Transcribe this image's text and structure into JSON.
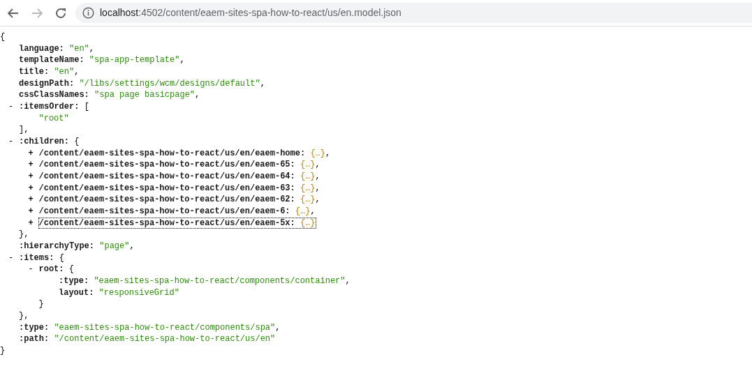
{
  "browser": {
    "back": {
      "disabled": false
    },
    "forward": {
      "disabled": true
    },
    "address": {
      "host": "localhost",
      "path": ":4502/content/eaem-sites-spa-how-to-react/us/en.model.json"
    }
  },
  "document": {
    "open": "{",
    "close": "}",
    "entries": [
      {
        "key": "language:",
        "value": "\"en\"",
        "kind": "string",
        "comma": ","
      },
      {
        "key": "templateName:",
        "value": "\"spa-app-template\"",
        "kind": "string",
        "comma": ","
      },
      {
        "key": "title:",
        "value": "\"en\"",
        "kind": "string",
        "comma": ","
      },
      {
        "key": "designPath:",
        "value": "\"/libs/settings/wcm/designs/default\"",
        "kind": "string",
        "comma": ","
      },
      {
        "key": "cssClassNames:",
        "value": "\"spa page basicpage\"",
        "kind": "string",
        "comma": ","
      },
      {
        "toggle": "-",
        "expanded": true,
        "key": ":itemsOrder:",
        "open": "[",
        "close": "],",
        "children": [
          {
            "value": "\"root\"",
            "kind": "string"
          }
        ]
      },
      {
        "toggle": "-",
        "expanded": true,
        "key": ":children:",
        "open": "{",
        "close": "},",
        "children": [
          {
            "toggle": "+",
            "expanded": false,
            "focused": false,
            "key": "/content/eaem-sites-spa-how-to-react/us/en/eaem-home:",
            "value": "{…}",
            "kind": "collapsed",
            "comma": ","
          },
          {
            "toggle": "+",
            "expanded": false,
            "focused": false,
            "key": "/content/eaem-sites-spa-how-to-react/us/en/eaem-65:",
            "value": "{…}",
            "kind": "collapsed",
            "comma": ","
          },
          {
            "toggle": "+",
            "expanded": false,
            "focused": false,
            "key": "/content/eaem-sites-spa-how-to-react/us/en/eaem-64:",
            "value": "{…}",
            "kind": "collapsed",
            "comma": ","
          },
          {
            "toggle": "+",
            "expanded": false,
            "focused": false,
            "key": "/content/eaem-sites-spa-how-to-react/us/en/eaem-63:",
            "value": "{…}",
            "kind": "collapsed",
            "comma": ","
          },
          {
            "toggle": "+",
            "expanded": false,
            "focused": false,
            "key": "/content/eaem-sites-spa-how-to-react/us/en/eaem-62:",
            "value": "{…}",
            "kind": "collapsed",
            "comma": ","
          },
          {
            "toggle": "+",
            "expanded": false,
            "focused": false,
            "key": "/content/eaem-sites-spa-how-to-react/us/en/eaem-6:",
            "value": "{…}",
            "kind": "collapsed",
            "comma": ","
          },
          {
            "toggle": "+",
            "expanded": false,
            "focused": true,
            "key": "/content/eaem-sites-spa-how-to-react/us/en/eaem-5x:",
            "value": "{…}",
            "kind": "collapsed"
          }
        ]
      },
      {
        "key": ":hierarchyType:",
        "value": "\"page\"",
        "kind": "string",
        "comma": ","
      },
      {
        "toggle": "-",
        "expanded": true,
        "key": ":items:",
        "open": "{",
        "close": "},",
        "children": [
          {
            "toggle": "-",
            "expanded": true,
            "key": "root:",
            "open": "{",
            "close": "}",
            "children": [
              {
                "key": ":type:",
                "value": "\"eaem-sites-spa-how-to-react/components/container\"",
                "kind": "string",
                "comma": ","
              },
              {
                "key": "layout:",
                "value": "\"responsiveGrid\"",
                "kind": "string"
              }
            ]
          }
        ]
      },
      {
        "key": ":type:",
        "value": "\"eaem-sites-spa-how-to-react/components/spa\"",
        "kind": "string",
        "comma": ","
      },
      {
        "key": ":path:",
        "value": "\"/content/eaem-sites-spa-how-to-react/us/en\"",
        "kind": "string"
      }
    ]
  }
}
